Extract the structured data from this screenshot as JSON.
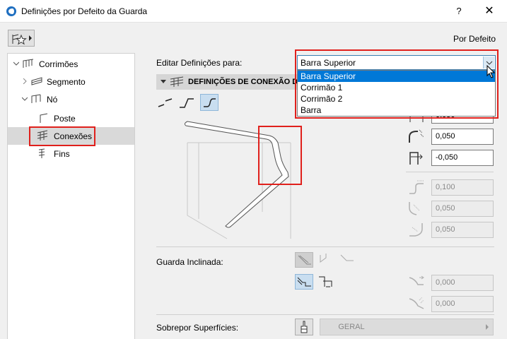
{
  "window": {
    "title": "Definições por Defeito da Guarda",
    "help": "?",
    "close": "✕"
  },
  "header": {
    "default_label": "Por Defeito"
  },
  "tree": {
    "items": [
      {
        "label": "Corrimões"
      },
      {
        "label": "Segmento"
      },
      {
        "label": "Nó"
      },
      {
        "label": "Poste"
      },
      {
        "label": "Conexões"
      },
      {
        "label": "Fins"
      }
    ]
  },
  "edit_for": {
    "label": "Editar Definições para:",
    "selected": "Barra Superior",
    "options": [
      "Barra Superior",
      "Corrimão 1",
      "Corrimão 2",
      "Barra"
    ]
  },
  "section": {
    "title": "DEFINIÇÕES DE CONEXÃO DE"
  },
  "params": {
    "p1": "0,050",
    "p2": "0,050",
    "p3": "-0,050",
    "p4": "0,100",
    "p5": "0,050",
    "p6": "0,050"
  },
  "inclined": {
    "label": "Guarda Inclinada:",
    "p1": "0,000",
    "p2": "0,000"
  },
  "overrides": {
    "label": "Sobrepor Superfícies:",
    "material": "GERAL"
  },
  "colors": {
    "highlight": "#0078d7",
    "annotation": "#e0201c"
  }
}
